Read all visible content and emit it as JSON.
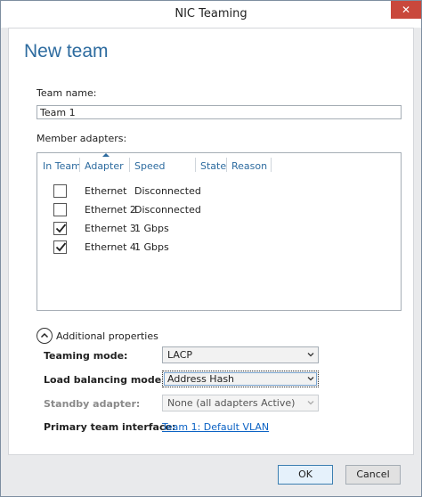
{
  "window": {
    "title": "NIC Teaming",
    "close_glyph": "✕"
  },
  "header": {
    "title": "New team"
  },
  "team_name": {
    "label": "Team name:",
    "value": "Team 1"
  },
  "member_adapters": {
    "label": "Member adapters:",
    "columns": [
      "In Team",
      "Adapter",
      "Speed",
      "State",
      "Reason"
    ],
    "rows": [
      {
        "checked": false,
        "adapter": "Ethernet",
        "speed": "Disconnected",
        "state": "",
        "reason": ""
      },
      {
        "checked": false,
        "adapter": "Ethernet 2",
        "speed": "Disconnected",
        "state": "",
        "reason": ""
      },
      {
        "checked": true,
        "adapter": "Ethernet 3",
        "speed": "1 Gbps",
        "state": "",
        "reason": ""
      },
      {
        "checked": true,
        "adapter": "Ethernet 4",
        "speed": "1 Gbps",
        "state": "",
        "reason": ""
      }
    ]
  },
  "additional_properties": {
    "label": "Additional properties",
    "expanded": true,
    "icon": "chevron-up-icon"
  },
  "teaming_mode": {
    "label": "Teaming mode:",
    "value": "LACP"
  },
  "load_balancing_mode": {
    "label": "Load balancing mode:",
    "value": "Address Hash"
  },
  "standby_adapter": {
    "label": "Standby adapter:",
    "value": "None (all adapters Active)"
  },
  "primary_team_interface": {
    "label": "Primary team interface:",
    "link": "Team 1: Default VLAN"
  },
  "buttons": {
    "ok": "OK",
    "cancel": "Cancel"
  },
  "colors": {
    "accent": "#2d6b9f",
    "link": "#0b62c4",
    "close": "#c9483c"
  }
}
